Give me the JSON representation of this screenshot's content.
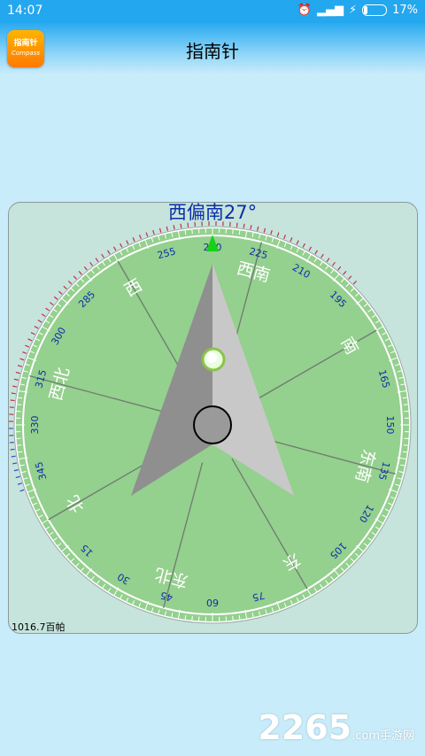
{
  "status": {
    "time": "14:07",
    "battery": "17%",
    "battery_level": 0.17
  },
  "app": {
    "title": "指南针",
    "icon_line1": "指南针",
    "icon_line2": "Compass"
  },
  "compass": {
    "heading_text": "西偏南27°",
    "heading_deg": 240,
    "pressure": "1016.7百帕",
    "directions": [
      "西南",
      "西",
      "西北",
      "北",
      "东北",
      "东",
      "东南",
      "南"
    ],
    "degree_labels": [
      "225",
      "240",
      "255",
      "285",
      "300",
      "315",
      "330",
      "345",
      "15",
      "30",
      "45",
      "60",
      "75",
      "105",
      "120",
      "135",
      "150",
      "165",
      "195",
      "210"
    ],
    "colors": {
      "dial": "#94d08e",
      "panel": "#c6e4dc",
      "needle_dark": "#8f8f8f",
      "needle_light": "#c8c8c8",
      "marker": "#16d116",
      "text_blue": "#0d2ea8"
    }
  },
  "watermark": {
    "brand": "2265",
    "suffix": ".com手游网"
  }
}
